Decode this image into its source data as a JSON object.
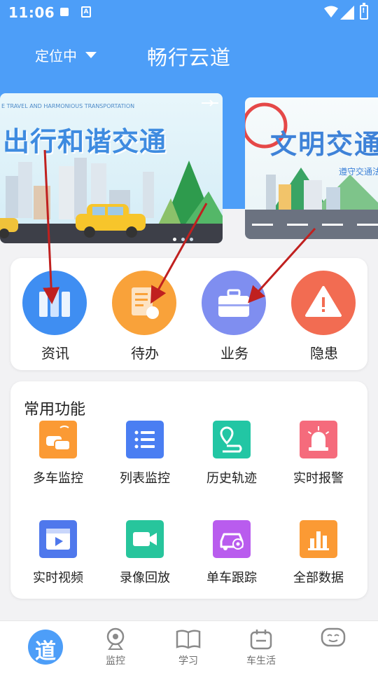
{
  "status_bar": {
    "time": "11:06",
    "keyboard_label": "A"
  },
  "header": {
    "location": "定位中",
    "title": "畅行云道"
  },
  "banners": [
    {
      "tagline": "E TRAVEL AND HARMONIOUS TRANSPORTATION",
      "headline": "出行和谐交通"
    },
    {
      "headline": "文明交通",
      "subtitle": "遵守交通法"
    }
  ],
  "quick_actions": [
    {
      "label": "资讯",
      "color": "#3f8ef2",
      "icon": "books-icon"
    },
    {
      "label": "待办",
      "color": "#f9a23a",
      "icon": "todo-doc-icon"
    },
    {
      "label": "业务",
      "color": "#7f8ef0",
      "icon": "briefcase-icon"
    },
    {
      "label": "隐患",
      "color": "#f26c52",
      "icon": "warning-icon"
    }
  ],
  "common_functions": {
    "title": "常用功能",
    "items": [
      {
        "label": "多车监控",
        "color": "#fb9a34",
        "icon": "multi-car-icon"
      },
      {
        "label": "列表监控",
        "color": "#4a7ef2",
        "icon": "list-icon"
      },
      {
        "label": "历史轨迹",
        "color": "#22c6a4",
        "icon": "route-pin-icon"
      },
      {
        "label": "实时报警",
        "color": "#f56b7c",
        "icon": "alarm-light-icon"
      },
      {
        "label": "实时视频",
        "color": "#4f78ec",
        "icon": "video-icon"
      },
      {
        "label": "录像回放",
        "color": "#27c59c",
        "icon": "camera-icon"
      },
      {
        "label": "单车跟踪",
        "color": "#b95cee",
        "icon": "car-track-icon"
      },
      {
        "label": "全部数据",
        "color": "#fb9a34",
        "icon": "bar-data-icon"
      }
    ]
  },
  "bottom_nav": [
    {
      "label": "",
      "icon": "home-dao-icon",
      "char": "道"
    },
    {
      "label": "监控",
      "icon": "webcam-icon"
    },
    {
      "label": "学习",
      "icon": "book-open-icon"
    },
    {
      "label": "车生活",
      "icon": "calendar-icon"
    },
    {
      "label": "",
      "icon": "face-icon"
    }
  ]
}
